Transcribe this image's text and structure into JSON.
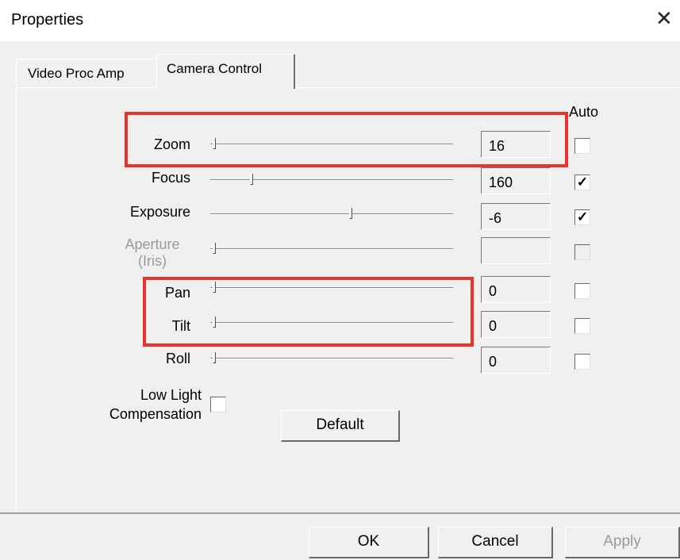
{
  "window": {
    "title": "Properties",
    "close_glyph": "✕"
  },
  "tabs": [
    {
      "label": "Video Proc Amp",
      "active": false
    },
    {
      "label": "Camera Control",
      "active": true
    }
  ],
  "auto_header": "Auto",
  "controls": [
    {
      "name": "zoom",
      "label": "Zoom",
      "value": "16",
      "auto": false,
      "enabled": true,
      "slider_pos": 0.0
    },
    {
      "name": "focus",
      "label": "Focus",
      "value": "160",
      "auto": true,
      "enabled": true,
      "slider_pos": 0.16
    },
    {
      "name": "exposure",
      "label": "Exposure",
      "value": "-6",
      "auto": true,
      "enabled": true,
      "slider_pos": 0.58
    },
    {
      "name": "aperture",
      "label_line1": "Aperture",
      "label_line2": "(Iris)",
      "value": "",
      "auto": false,
      "enabled": false,
      "slider_pos": 0.0
    },
    {
      "name": "pan",
      "label": "Pan",
      "value": "0",
      "auto": false,
      "enabled": true,
      "slider_pos": 0.0
    },
    {
      "name": "tilt",
      "label": "Tilt",
      "value": "0",
      "auto": false,
      "enabled": true,
      "slider_pos": 0.0
    },
    {
      "name": "roll",
      "label": "Roll",
      "value": "0",
      "auto": false,
      "enabled": true,
      "slider_pos": 0.0
    }
  ],
  "low_light": {
    "label_line1": "Low Light",
    "label_line2": "Compensation",
    "checked": false
  },
  "default_button": "Default",
  "footer_buttons": {
    "ok": "OK",
    "cancel": "Cancel",
    "apply": "Apply"
  },
  "colors": {
    "highlight": "#e8342a",
    "background": "#f0f0f0"
  },
  "check_glyph": "✓"
}
